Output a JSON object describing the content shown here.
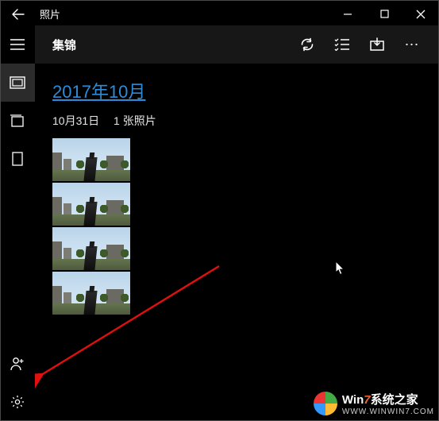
{
  "titlebar": {
    "app_name": "照片"
  },
  "toolbar": {
    "title": "集锦"
  },
  "group": {
    "header": "2017年10月",
    "date": "10月31日",
    "count": "1 张照片"
  },
  "watermark": {
    "line1_pre": "Win",
    "line1_seven": "7",
    "line1_post": "系统之家",
    "line2": "WWW.WINWIN7.COM"
  }
}
